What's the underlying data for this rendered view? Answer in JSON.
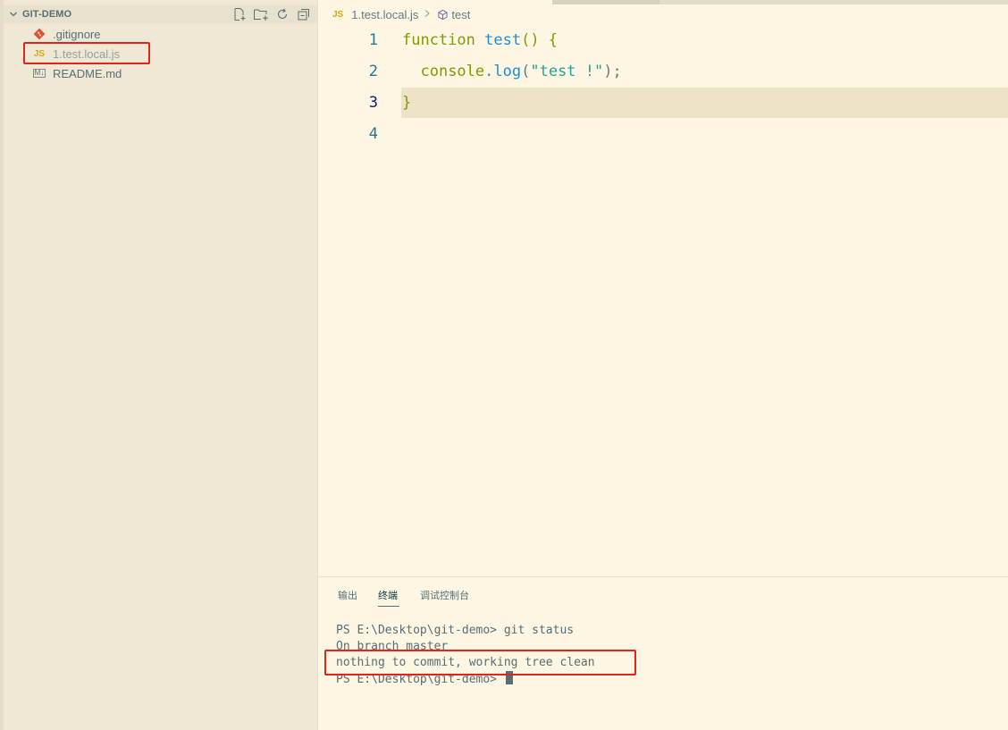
{
  "explorer": {
    "title": "GIT-DEMO",
    "actions": [
      "new-file-icon",
      "new-folder-icon",
      "refresh-icon",
      "collapse-all-icon"
    ],
    "files": [
      {
        "name": ".gitignore",
        "icon": "git-icon"
      },
      {
        "name": "1.test.local.js",
        "icon": "js-icon",
        "badge": "JS"
      },
      {
        "name": "README.md",
        "icon": "markdown-icon",
        "badge": "M↓"
      }
    ]
  },
  "breadcrumb": {
    "badge": "JS",
    "file": "1.test.local.js",
    "symbol": "test",
    "symbol_icon": "symbol-method-icon"
  },
  "editor": {
    "line_numbers": [
      "1",
      "2",
      "3",
      "4"
    ],
    "active_line": "3",
    "lines": {
      "l1": {
        "kw": "function",
        "sp": " ",
        "fn": "test",
        "rest": "() {"
      },
      "l2": {
        "indent": "  ",
        "obj": "console",
        "dot": ".",
        "method": "log",
        "open": "(",
        "str": "\"test !\"",
        "close": ");"
      },
      "l3": {
        "brace": "}"
      }
    }
  },
  "panel": {
    "tabs": [
      {
        "label": "输出"
      },
      {
        "label": "终端",
        "active": true
      },
      {
        "label": "调试控制台"
      }
    ],
    "terminal_lines": [
      "PS E:\\Desktop\\git-demo> git status",
      "On branch master",
      "nothing to commit, working tree clean",
      "PS E:\\Desktop\\git-demo> "
    ]
  },
  "colors": {
    "editor_bg": "#fdf6e3",
    "sidebar_bg": "#eee8d5",
    "highlight_red": "#e3241c",
    "keyword": "#859900",
    "function": "#268bd2",
    "string": "#2aa198"
  }
}
